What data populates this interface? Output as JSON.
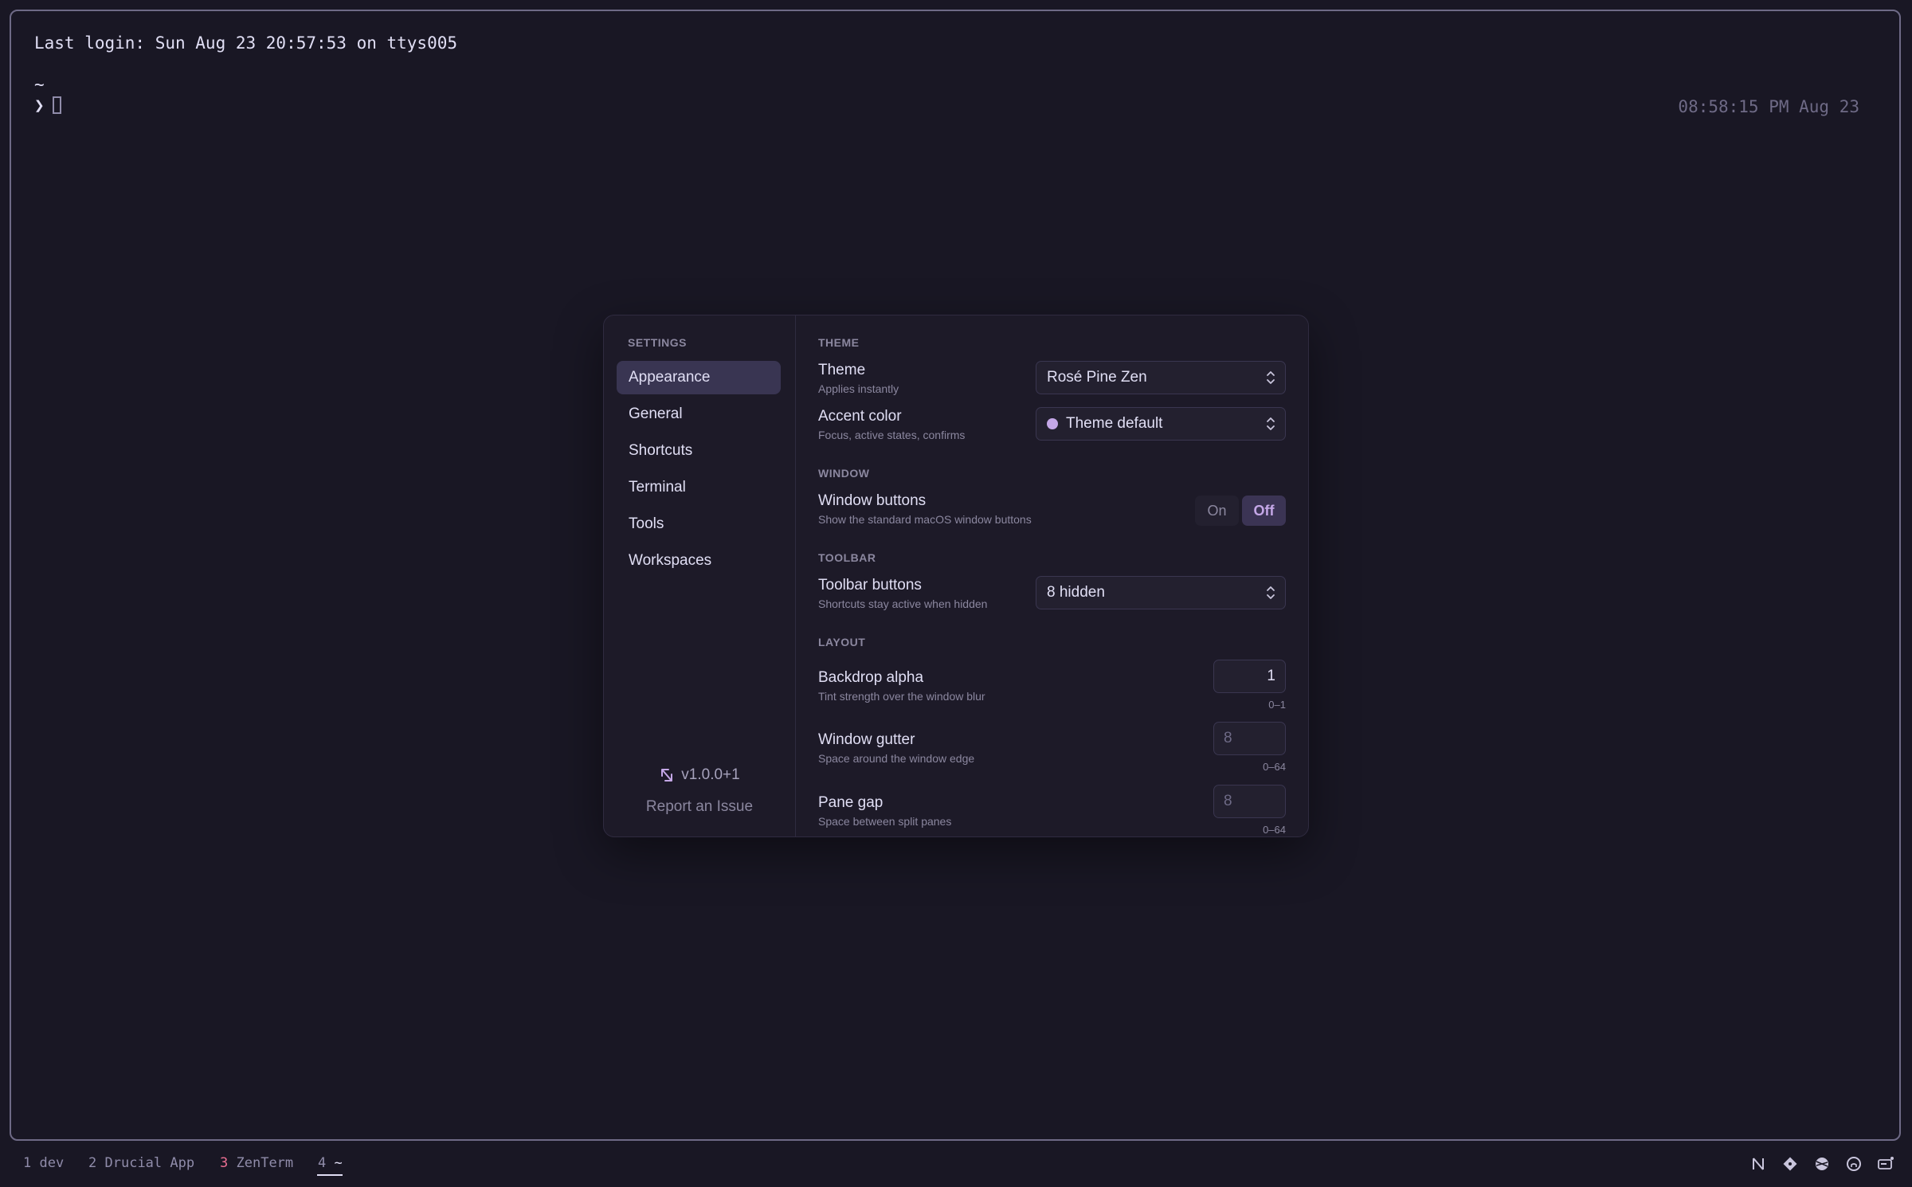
{
  "terminal": {
    "last_login": "Last login: Sun Aug 23 20:57:53 on ttys005",
    "cwd_line": "~",
    "prompt_symbol": "❯",
    "clock": "08:58:15 PM Aug 23"
  },
  "settings": {
    "header": "SETTINGS",
    "nav": [
      {
        "label": "Appearance",
        "active": true
      },
      {
        "label": "General"
      },
      {
        "label": "Shortcuts"
      },
      {
        "label": "Terminal"
      },
      {
        "label": "Tools"
      },
      {
        "label": "Workspaces"
      }
    ],
    "version": "v1.0.0+1",
    "report_link": "Report an Issue",
    "sections": {
      "theme": {
        "label": "THEME",
        "theme_row": {
          "title": "Theme",
          "subtitle": "Applies instantly",
          "value": "Rosé Pine Zen"
        },
        "accent_row": {
          "title": "Accent color",
          "subtitle": "Focus, active states, confirms",
          "value": "Theme default",
          "swatch": "#c4a7e7"
        }
      },
      "window": {
        "label": "WINDOW",
        "buttons_row": {
          "title": "Window buttons",
          "subtitle": "Show the standard macOS window buttons",
          "on_label": "On",
          "off_label": "Off",
          "selected": "Off"
        }
      },
      "toolbar": {
        "label": "TOOLBAR",
        "buttons_row": {
          "title": "Toolbar buttons",
          "subtitle": "Shortcuts stay active when hidden",
          "value": "8 hidden"
        }
      },
      "layout": {
        "label": "LAYOUT",
        "backdrop": {
          "title": "Backdrop alpha",
          "subtitle": "Tint strength over the window blur",
          "value": "1",
          "range": "0–1"
        },
        "gutter": {
          "title": "Window gutter",
          "subtitle": "Space around the window edge",
          "placeholder": "8",
          "range": "0–64"
        },
        "pane_gap": {
          "title": "Pane gap",
          "subtitle": "Space between split panes",
          "placeholder": "8",
          "range": "0–64"
        }
      }
    }
  },
  "tabbar": {
    "tabs": [
      {
        "num": "1",
        "label": "dev"
      },
      {
        "num": "2",
        "label": "Drucial App"
      },
      {
        "num": "3",
        "label": "ZenTerm",
        "num_color": "#eb6f92"
      },
      {
        "num": "4",
        "label": "~",
        "active": true
      }
    ],
    "tray_icons": [
      "notion-icon",
      "git-icon",
      "globe-icon",
      "github-icon",
      "display-icon"
    ]
  },
  "colors": {
    "background": "#191724",
    "text": "#e0def4",
    "muted": "#8b879f",
    "accent": "#c4a7e7",
    "love": "#eb6f92"
  }
}
